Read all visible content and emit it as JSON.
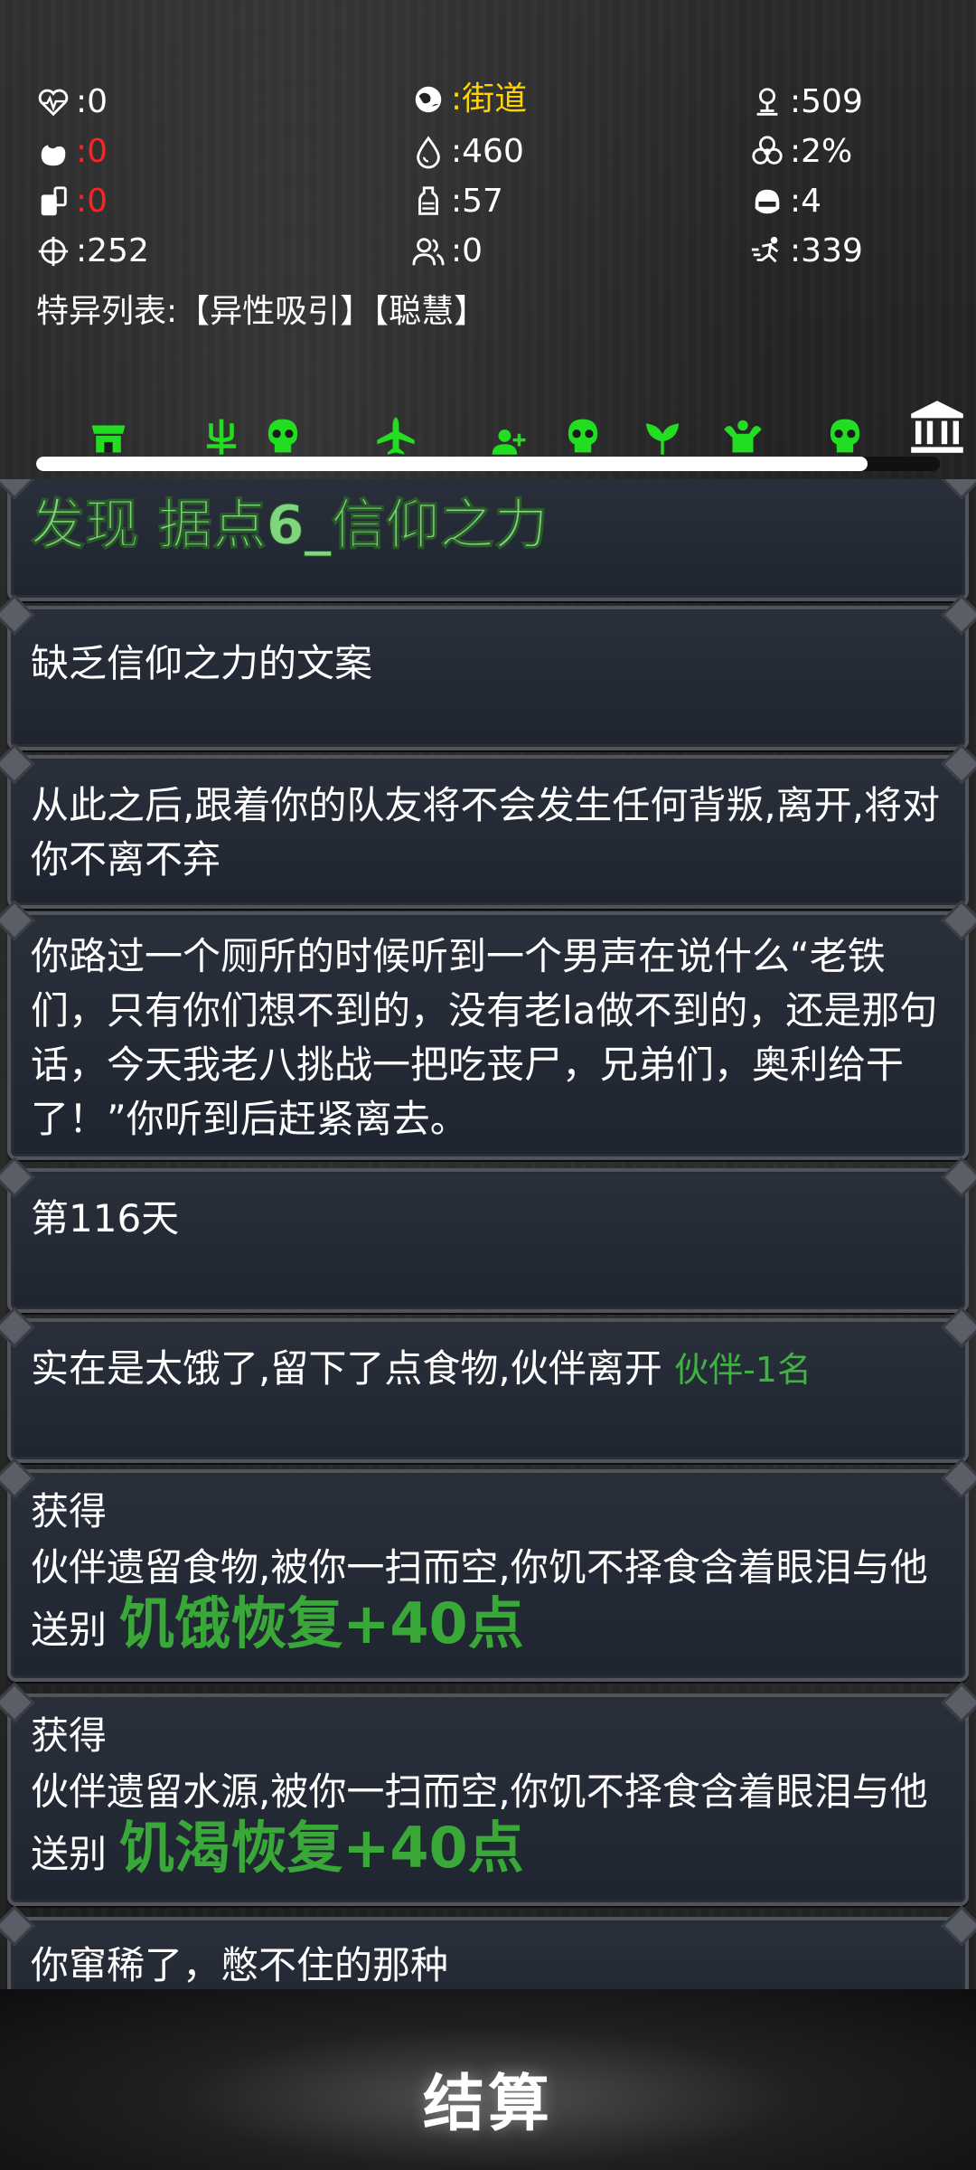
{
  "stats": {
    "health": ":0",
    "location": ":街道",
    "distance": ":509",
    "hunger": ":0",
    "water": ":460",
    "infection": ":2%",
    "thirst": ":0",
    "bottles": ":57",
    "armor": ":4",
    "aim": ":252",
    "companions": ":0",
    "speed": ":339",
    "traits": "特异列表:【异性吸引】【聪慧】"
  },
  "progress": 0.92,
  "iconbar": [
    "shop-icon",
    "trident-icon",
    "skull-icon",
    "airplane-icon",
    "add-user-icon",
    "skull-icon",
    "plant-icon",
    "muscle-icon",
    "skull-icon",
    "museum-icon"
  ],
  "log": [
    {
      "text": "发现 据点6_信仰之力"
    },
    {
      "text": "缺乏信仰之力的文案"
    },
    {
      "text": "从此之后,跟着你的队友将不会发生任何背叛,离开,将对你不离不弃"
    },
    {
      "text": "你路过一个厕所的时候听到一个男声在说什么“老铁们，只有你们想不到的，没有老la做不到的，还是那句话，今天我老八挑战一把吃丧尸，兄弟们，奥利给干了！”你听到后赶紧离去。"
    },
    {
      "text": "第116天"
    },
    {
      "text": "实在是太饿了,留下了点食物,伙伴离开",
      "tag": "伙伴-1名"
    },
    {
      "head": "获得",
      "text": "伙伴遗留食物,被你一扫而空,你饥不择食含着眼泪与他送别",
      "tag": "饥饿恢复+40点"
    },
    {
      "head": "获得",
      "text": "伙伴遗留水源,被你一扫而空,你饥不择食含着眼泪与他送别",
      "tag": "饥渴恢复+40点"
    },
    {
      "text": "你窜稀了，憋不住的那种"
    }
  ],
  "settle_label": "结算",
  "colors": {
    "accent_green": "#39a839",
    "title_green": "#7fd67f",
    "warn_red": "#ff2222",
    "location_yellow": "#ffd400"
  }
}
